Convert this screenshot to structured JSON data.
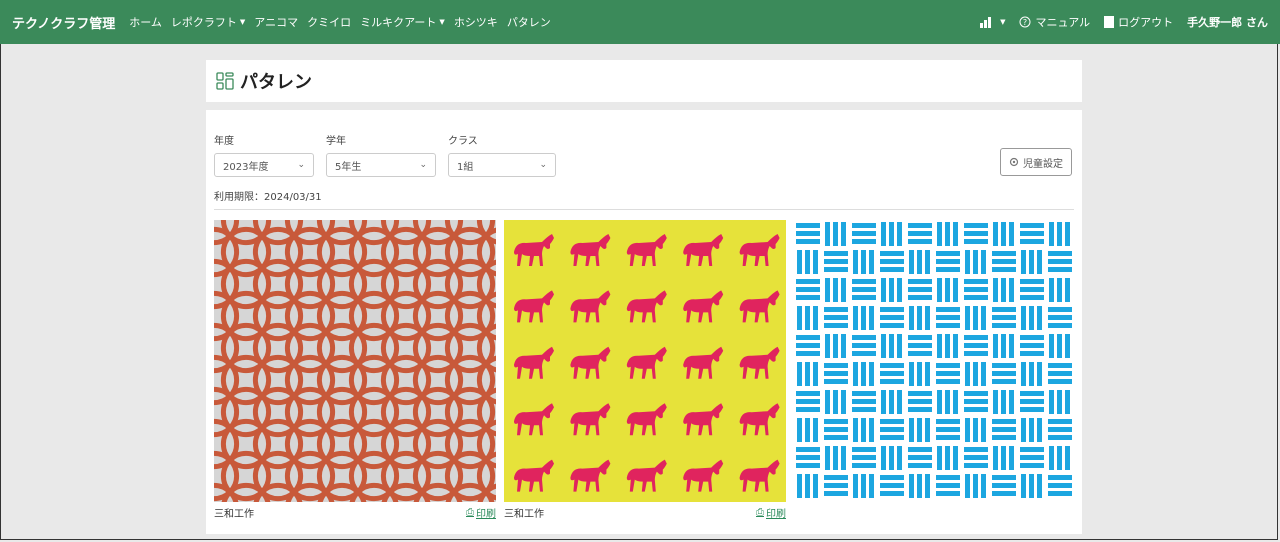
{
  "app": {
    "brand": "テクノクラフ管理"
  },
  "nav": {
    "items": [
      {
        "label": "ホーム",
        "dropdown": false
      },
      {
        "label": "レポクラフト",
        "dropdown": true
      },
      {
        "label": "アニコマ",
        "dropdown": false
      },
      {
        "label": "クミイロ",
        "dropdown": false
      },
      {
        "label": "ミルキクアート",
        "dropdown": true
      },
      {
        "label": "ホシツキ",
        "dropdown": false
      },
      {
        "label": "パタレン",
        "dropdown": false
      }
    ],
    "manual": "マニュアル",
    "logout": "ログアウト",
    "user": "手久野一郎 さん"
  },
  "page": {
    "title": "パタレン"
  },
  "filters": {
    "year": {
      "label": "年度",
      "value": "2023年度"
    },
    "grade": {
      "label": "学年",
      "value": "5年生"
    },
    "class": {
      "label": "クラス",
      "value": "1組"
    }
  },
  "period": "利用期限：2024/03/31",
  "child_settings": "児童設定",
  "patterns": [
    {
      "name": "三和工作",
      "print": "印刷",
      "colors": {
        "bg": "#d6d6d6",
        "fg": "#c8593a"
      }
    },
    {
      "name": "三和工作",
      "print": "印刷",
      "colors": {
        "bg": "#e6e23a",
        "fg": "#e0245e"
      }
    },
    {
      "name": "",
      "print": "",
      "colors": {
        "bg": "#ffffff",
        "fg": "#1ca6e0"
      }
    }
  ],
  "icons": {
    "analytics": "bar-chart-icon",
    "help": "question-circle-icon",
    "logout": "logout-icon",
    "pattern": "grid-icon",
    "print": "printer-icon",
    "settings": "gear-icon"
  }
}
